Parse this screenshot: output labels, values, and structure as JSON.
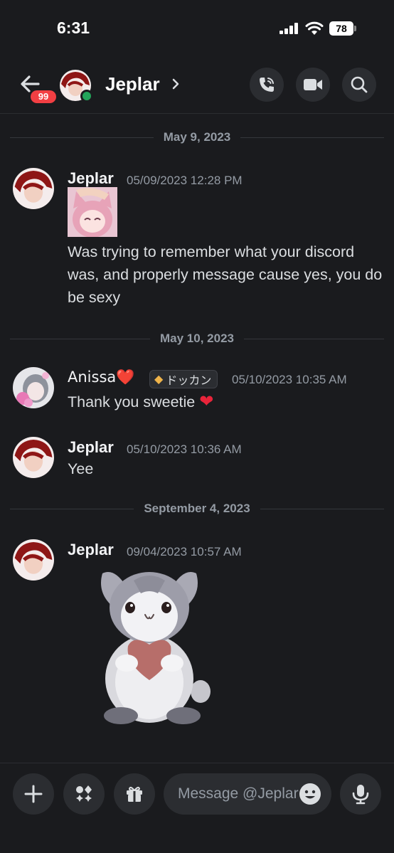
{
  "status_bar": {
    "time": "6:31",
    "battery": "78"
  },
  "header": {
    "channel_name": "Jeplar",
    "unread_badge": "99"
  },
  "dates": {
    "d1": "May 9, 2023",
    "d2": "May 10, 2023",
    "d3": "September 4, 2023"
  },
  "messages": [
    {
      "author": "Jeplar",
      "timestamp": "05/09/2023 12:28 PM",
      "text": "Was trying to remember what your discord was, and properly message cause yes, you do be sexy"
    },
    {
      "author": "Anissa",
      "author_emoji": "❤️",
      "role_tag": "ドッカン",
      "timestamp": "05/10/2023 10:35 AM",
      "text": "Thank you sweetie"
    },
    {
      "author": "Jeplar",
      "timestamp": "05/10/2023 10:36 AM",
      "text": "Yee"
    },
    {
      "author": "Jeplar",
      "timestamp": "09/04/2023 10:57 AM",
      "sticker": "bunny-holding-heart"
    }
  ],
  "composer": {
    "placeholder": "Message @Jeplar"
  },
  "icons": [
    "back-arrow-icon",
    "phone-call-icon",
    "video-camera-icon",
    "search-icon",
    "plus-icon",
    "apps-icon",
    "gift-icon",
    "emoji-icon",
    "microphone-icon"
  ],
  "colors": {
    "background": "#1a1b1e",
    "surface": "#2b2d31",
    "online": "#23a55a",
    "badge": "#f23f43"
  }
}
